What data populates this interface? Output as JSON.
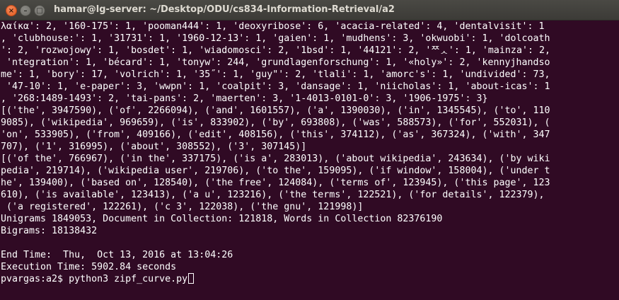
{
  "window": {
    "title": "hamar@lg-server: ~/Desktop/ODU/cs834-Information-Retrieval/a2",
    "close_glyph": "×",
    "min_glyph": "–",
    "max_glyph": "□"
  },
  "colors": {
    "terminal_bg": "#300a24",
    "terminal_fg": "#ffffff",
    "titlebar_bg": "#3c3b37",
    "close_button": "#e35a1c"
  },
  "terminal": {
    "lines": [
      "λαίκα': 2, '160-175': 1, 'pooman444': 1, 'deoxyribose': 6, 'acacia-related': 4, 'dentalvisit': 1",
      ", 'clubhouse:': 1, '31731': 1, '1960-12-13': 1, 'gaien': 1, 'mudhens': 3, 'okwuobi': 1, 'dolcoath",
      "': 2, 'rozwojowy': 1, 'bosdet': 1, 'wiadomosci': 2, '1bsd': 1, '44121': 2, 'ᄍᆺ': 1, 'mainza': 2,",
      " 'ntegration': 1, 'bécard': 1, 'tonyw': 244, 'grundlagenforschung': 1, '«holy»': 2, 'kennyjhandso",
      "me': 1, 'bory': 17, 'volrich': 1, '35˝': 1, 'guy\"': 2, 'tlali': 1, 'amorc's': 1, 'undivided': 73,",
      " '47-10': 1, 'e-paper': 3, 'wwpn': 1, 'coalpit': 3, 'dansage': 1, 'niicholas': 1, 'about-icas': 1",
      ", '268:1489-1493': 2, 'tai-pans': 2, 'maerten': 3, '1-4013-0101-0': 3, '1906-1975': 3}",
      "[('the', 3947590), ('of', 2266094), ('and', 1601557), ('a', 1390030), ('in', 1345545), ('to', 110",
      "9085), ('wikipedia', 969659), ('is', 833902), ('by', 693808), ('was', 588573), ('for', 552031), (",
      "'on', 533905), ('from', 409166), ('edit', 408156), ('this', 374112), ('as', 367324), ('with', 347",
      "707), ('1', 316995), ('about', 308552), ('3', 307145)]",
      "[('of the', 766967), ('in the', 337175), ('is a', 283013), ('about wikipedia', 243634), ('by wiki",
      "pedia', 219714), ('wikipedia user', 219706), ('to the', 159095), ('if window', 158004), ('under t",
      "he', 139400), ('based on', 128540), ('the free', 124084), ('terms of', 123945), ('this page', 123",
      "610), ('is available', 123413), ('a u', 123216), ('the terms', 122521), ('for details', 122379),",
      " ('a registered', 122261), ('c 3', 122038), ('the gnu', 121998)]",
      "Unigrams 1849053, Document in Collection: 121818, Words in Collection 82376190",
      "Bigrams: 18138432",
      "",
      "End Time:  Thu,  Oct 13, 2016 at 13:04:26",
      "Execution Time: 5902.84 seconds"
    ],
    "prompt": "pvargas:a2$ ",
    "command": "python3 zipf_curve.py"
  }
}
